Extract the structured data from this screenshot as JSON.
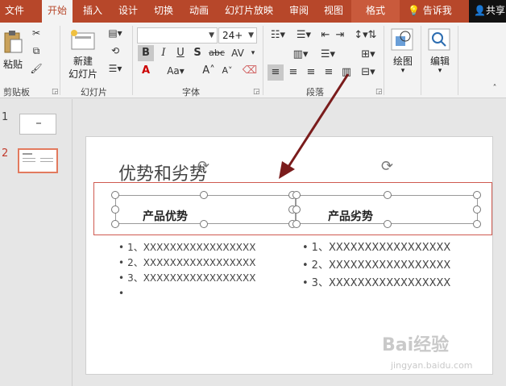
{
  "tabs": [
    "文件",
    "开始",
    "插入",
    "设计",
    "切换",
    "动画",
    "幻灯片放映",
    "审阅",
    "视图",
    "格式"
  ],
  "tell_me": "告诉我",
  "share": "共享",
  "clipboard": {
    "paste": "粘贴",
    "label": "剪贴板"
  },
  "slides_group": {
    "new_slide_line1": "新建",
    "new_slide_line2": "幻灯片",
    "label": "幻灯片"
  },
  "font_group": {
    "font_name": "",
    "font_size": "24+",
    "label": "字体"
  },
  "paragraph_group": {
    "label": "段落"
  },
  "drawing_label": "绘图",
  "editing_label": "编辑",
  "thumbnails": [
    {
      "number": "1"
    },
    {
      "number": "2"
    }
  ],
  "slide": {
    "title": "优势和劣势",
    "left_header": "产品优势",
    "right_header": "产品劣势",
    "left_items": [
      "1、XXXXXXXXXXXXXXXXX",
      "2、XXXXXXXXXXXXXXXXX",
      "3、XXXXXXXXXXXXXXXXX",
      ""
    ],
    "right_items": [
      "1、XXXXXXXXXXXXXXXXX",
      "2、XXXXXXXXXXXXXXXXX",
      "3、XXXXXXXXXXXXXXXXX"
    ]
  },
  "watermark": {
    "main": "Bai经验",
    "sub": "jingyan.baidu.com"
  },
  "colors": {
    "accent": "#b7472a",
    "highlight": "#cf5a50",
    "arrow": "#7a1c1c"
  }
}
